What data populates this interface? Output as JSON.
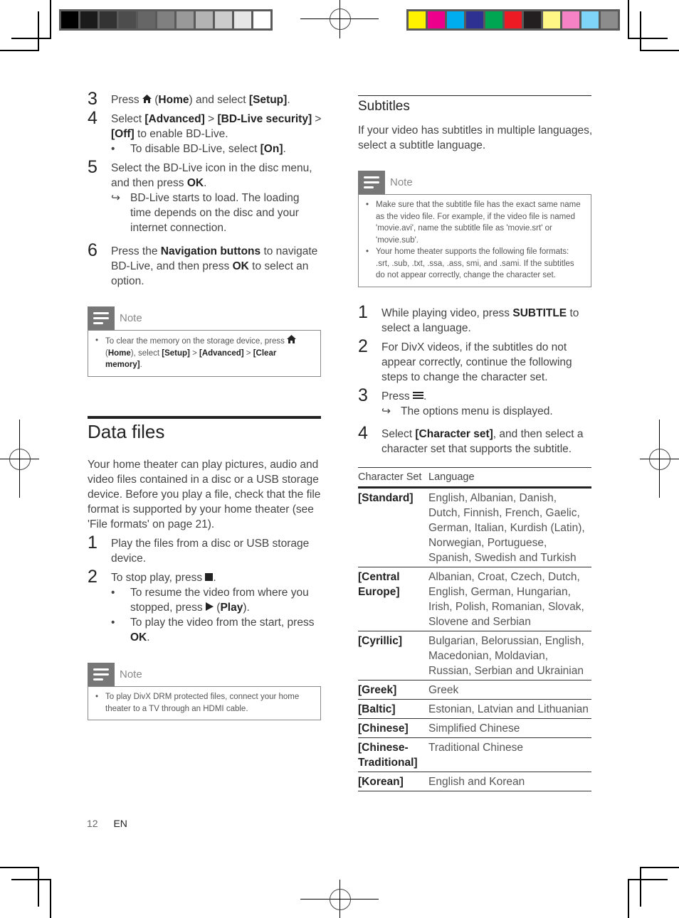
{
  "print_marks": {
    "gray_swatches": [
      "#000000",
      "#1a1a1a",
      "#333333",
      "#4d4d4d",
      "#666666",
      "#808080",
      "#999999",
      "#b3b3b3",
      "#cccccc",
      "#e6e6e6",
      "#ffffff"
    ],
    "color_swatches": [
      "#fff200",
      "#ec008c",
      "#00aeef",
      "#2e3192",
      "#00a651",
      "#ed1c24",
      "#231f20",
      "#fff685",
      "#f682c6",
      "#7fd5f7",
      "#8c8c8c"
    ]
  },
  "left": {
    "steps_top": [
      {
        "num": "3",
        "parts": [
          {
            "t": "Press "
          },
          {
            "icon": "home"
          },
          {
            "t": " ("
          },
          {
            "b": "Home"
          },
          {
            "t": ") and select "
          },
          {
            "b": "[Setup]"
          },
          {
            "t": "."
          }
        ]
      },
      {
        "num": "4",
        "parts": [
          {
            "t": "Select "
          },
          {
            "b": "[Advanced]"
          },
          {
            "t": " > "
          },
          {
            "b": "[BD-Live security]"
          },
          {
            "t": " > "
          },
          {
            "b": "[Off]"
          },
          {
            "t": " to enable BD-Live."
          }
        ],
        "subs": [
          {
            "mark": "•",
            "parts": [
              {
                "t": "To disable BD-Live, select "
              },
              {
                "b": "[On]"
              },
              {
                "t": "."
              }
            ]
          }
        ]
      },
      {
        "num": "5",
        "parts": [
          {
            "t": "Select the BD-Live icon in the disc menu, and then press "
          },
          {
            "b": "OK"
          },
          {
            "t": "."
          }
        ],
        "subs": [
          {
            "mark": "↳",
            "parts": [
              {
                "t": "BD-Live starts to load. The loading time depends on the disc and your internet connection."
              }
            ]
          }
        ]
      },
      {
        "num": "6",
        "parts": [
          {
            "t": "Press the "
          },
          {
            "b": "Navigation buttons"
          },
          {
            "t": " to navigate BD-Live, and then press "
          },
          {
            "b": "OK"
          },
          {
            "t": " to select an option."
          }
        ]
      }
    ],
    "note1": {
      "label": "Note",
      "items": [
        [
          {
            "t": "To clear the memory on the storage device, press "
          },
          {
            "icon": "home"
          },
          {
            "t": " ("
          },
          {
            "b": "Home"
          },
          {
            "t": "), select "
          },
          {
            "b": "[Setup]"
          },
          {
            "t": " > "
          },
          {
            "b": "[Advanced]"
          },
          {
            "t": " > "
          },
          {
            "b": "[Clear memory]"
          },
          {
            "t": "."
          }
        ]
      ]
    },
    "data_files": {
      "title": "Data files",
      "intro": "Your home theater can play pictures, audio and video files contained in a disc or a USB storage device. Before you play a file, check that the file format is supported by your home theater (see 'File formats' on page 21).",
      "steps": [
        {
          "num": "1",
          "parts": [
            {
              "t": "Play the files from a disc or USB storage device."
            }
          ]
        },
        {
          "num": "2",
          "parts": [
            {
              "t": "To stop play, press "
            },
            {
              "icon": "stop"
            },
            {
              "t": "."
            }
          ],
          "subs": [
            {
              "mark": "•",
              "parts": [
                {
                  "t": "To resume the video from where you stopped, press "
                },
                {
                  "icon": "play"
                },
                {
                  "t": " ("
                },
                {
                  "b": "Play"
                },
                {
                  "t": ")."
                }
              ]
            },
            {
              "mark": "•",
              "parts": [
                {
                  "t": "To play the video from the start, press "
                },
                {
                  "b": "OK"
                },
                {
                  "t": "."
                }
              ]
            }
          ]
        }
      ]
    },
    "note2": {
      "label": "Note",
      "items": [
        [
          {
            "t": "To play DivX DRM protected files, connect your home theater to a TV through an HDMI cable."
          }
        ]
      ]
    }
  },
  "right": {
    "subtitles": {
      "title": "Subtitles",
      "intro": "If your video has subtitles in multiple languages, select a subtitle language."
    },
    "note": {
      "label": "Note",
      "items": [
        [
          {
            "t": "Make sure that the subtitle file has the exact same name as the video file. For example, if the video file is named 'movie.avi', name the subtitle file as 'movie.srt' or 'movie.sub'."
          }
        ],
        [
          {
            "t": "Your home theater supports the following file formats: .srt, .sub, .txt, .ssa, .ass, smi, and .sami. If the subtitles do not appear correctly, change the character set."
          }
        ]
      ]
    },
    "steps": [
      {
        "num": "1",
        "parts": [
          {
            "t": "While playing video, press "
          },
          {
            "b": "SUBTITLE"
          },
          {
            "t": " to select a language."
          }
        ]
      },
      {
        "num": "2",
        "parts": [
          {
            "t": "For DivX videos, if the subtitles do not appear correctly, continue the following steps to change the character set."
          }
        ]
      },
      {
        "num": "3",
        "parts": [
          {
            "t": "Press "
          },
          {
            "icon": "menu"
          },
          {
            "t": "."
          }
        ],
        "subs": [
          {
            "mark": "↳",
            "parts": [
              {
                "t": "The options menu is displayed."
              }
            ]
          }
        ]
      },
      {
        "num": "4",
        "parts": [
          {
            "t": "Select "
          },
          {
            "b": "[Character set]"
          },
          {
            "t": ", and then select a character set that supports the subtitle."
          }
        ]
      }
    ],
    "table": {
      "headers": [
        "Character Set",
        "Language"
      ],
      "rows": [
        [
          "[Standard]",
          "English, Albanian, Danish, Dutch, Finnish, French, Gaelic, German, Italian, Kurdish (Latin), Norwegian, Portuguese, Spanish, Swedish and Turkish"
        ],
        [
          "[Central Europe]",
          "Albanian, Croat, Czech, Dutch, English, German, Hungarian, Irish, Polish, Romanian, Slovak, Slovene and Serbian"
        ],
        [
          "[Cyrillic]",
          "Bulgarian, Belorussian, English, Macedonian, Moldavian, Russian, Serbian and Ukrainian"
        ],
        [
          "[Greek]",
          "Greek"
        ],
        [
          "[Baltic]",
          "Estonian, Latvian and Lithuanian"
        ],
        [
          "[Chinese]",
          "Simplified Chinese"
        ],
        [
          "[Chinese-Traditional]",
          "Traditional Chinese"
        ],
        [
          "[Korean]",
          "English and Korean"
        ]
      ]
    }
  },
  "footer": {
    "page": "12",
    "lang": "EN"
  }
}
